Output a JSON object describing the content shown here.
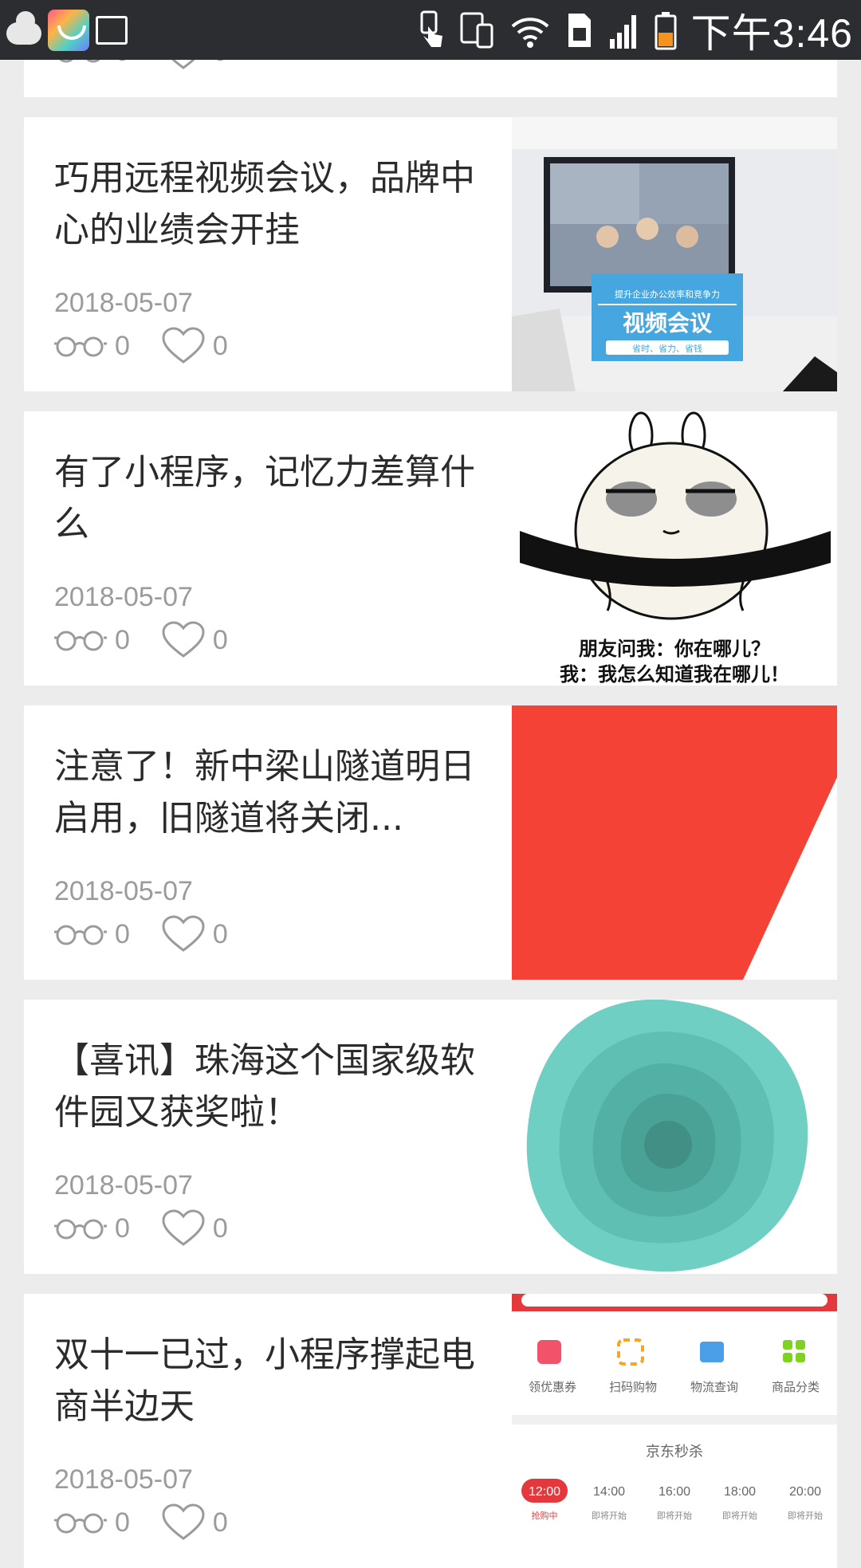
{
  "status_bar": {
    "time": "下午3:46"
  },
  "articles": [
    {
      "title": "",
      "date": "",
      "views": "0",
      "likes": "0"
    },
    {
      "title": "巧用远程视频会议，品牌中心的业绩会开挂",
      "date": "2018-05-07",
      "views": "0",
      "likes": "0",
      "thumb": {
        "sub": "提升企业办公效率和竞争力",
        "main": "视频会议",
        "tag": "省时、省力、省钱"
      }
    },
    {
      "title": "有了小程序，记忆力差算什么",
      "date": "2018-05-07",
      "views": "0",
      "likes": "0",
      "thumb": {
        "line1": "朋友问我：你在哪儿？",
        "line2": "我：我怎么知道我在哪儿！"
      }
    },
    {
      "title": "注意了！新中梁山隧道明日启用，旧隧道将关闭...",
      "date": "2018-05-07",
      "views": "0",
      "likes": "0"
    },
    {
      "title": "【喜讯】珠海这个国家级软件园又获奖啦！",
      "date": "2018-05-07",
      "views": "0",
      "likes": "0"
    },
    {
      "title": "双十一已过，小程序撑起电商半边天",
      "date": "2018-05-07",
      "views": "0",
      "likes": "0",
      "thumb": {
        "icons": [
          "领优惠券",
          "扫码购物",
          "物流查询",
          "商品分类"
        ],
        "section": "京东秒杀",
        "times": [
          "12:00",
          "14:00",
          "16:00",
          "18:00",
          "20:00"
        ],
        "states": [
          "抢购中",
          "即将开始",
          "即将开始",
          "即将开始",
          "即将开始"
        ]
      }
    }
  ]
}
